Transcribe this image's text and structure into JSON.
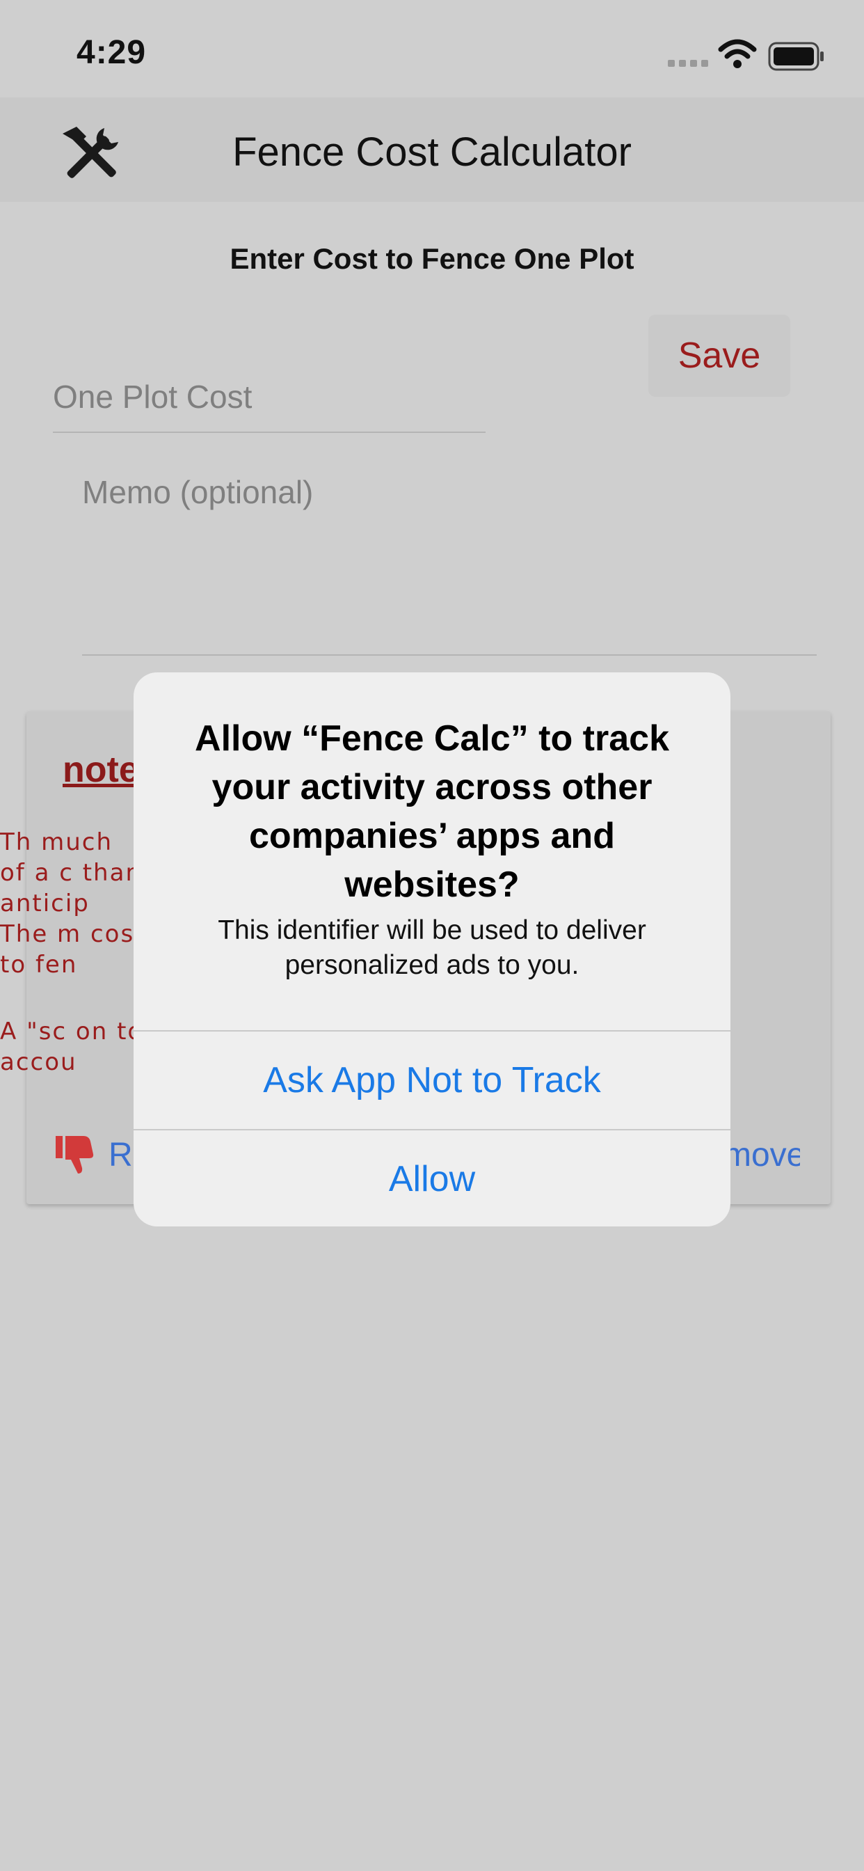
{
  "status_bar": {
    "time": "4:29",
    "icons": [
      "signal-icon",
      "wifi-icon",
      "battery-icon"
    ]
  },
  "nav": {
    "title": "Fence Cost Calculator",
    "icon": "tools-icon"
  },
  "form": {
    "heading": "Enter Cost to Fence One Plot",
    "save_label": "Save",
    "plot_cost_placeholder": "One Plot Cost",
    "memo_placeholder": "Memo (optional)"
  },
  "note": {
    "title": "note",
    "para1_lines": [
      "      Th                                                          much",
      "of a c                                                             than",
      "anticip",
      "The m                                                              cost",
      "to fen"
    ],
    "para2_lines": [
      "A  \"sc                                                         on  to",
      "accou"
    ],
    "report_label": "Re",
    "remove_label": "move"
  },
  "alert": {
    "title": "Allow “Fence Calc” to track your activity across other companies’ apps and websites?",
    "message": "This identifier will be used to deliver personalized ads to you.",
    "ask_not_track_label": "Ask App Not to Track",
    "allow_label": "Allow"
  },
  "colors": {
    "background": "#cfcfcf",
    "accent_red": "#9a1c1c",
    "link_blue": "#1a7ae6",
    "alert_bg": "#efefef"
  }
}
